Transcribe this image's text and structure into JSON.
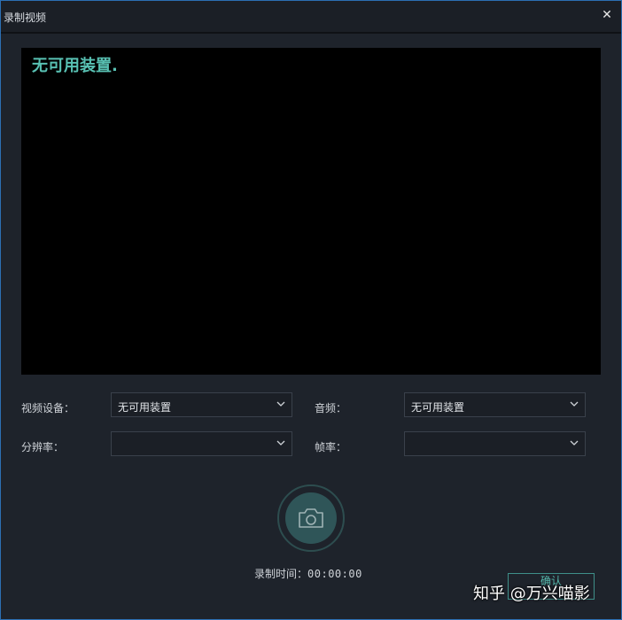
{
  "window": {
    "title": "录制视频",
    "close_glyph": "✕"
  },
  "preview": {
    "message": "无可用装置."
  },
  "settings": {
    "video_device_label": "视频设备：",
    "video_device_value": "无可用装置",
    "audio_label": "音频：",
    "audio_value": "无可用装置",
    "resolution_label": "分辨率：",
    "resolution_value": "",
    "framerate_label": "帧率：",
    "framerate_value": ""
  },
  "record": {
    "icon": "camera-icon",
    "time_label": "录制时间：",
    "time_value": "00:00:00"
  },
  "footer": {
    "ok_label": "确认"
  },
  "watermark": {
    "text": "知乎 @万兴喵影"
  },
  "colors": {
    "accent": "#58c0b2",
    "background": "#1e232b",
    "border": "#2c6fb3"
  }
}
